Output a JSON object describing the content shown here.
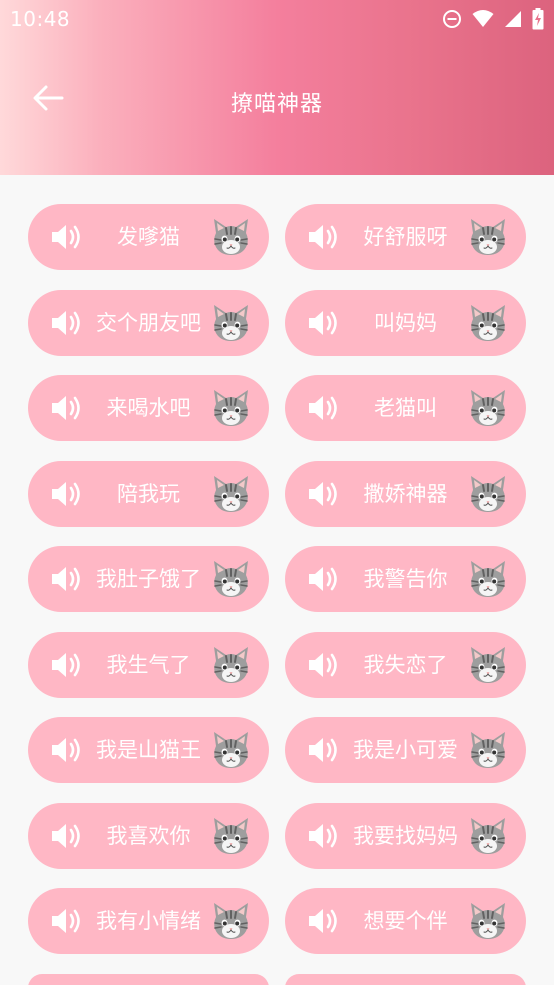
{
  "status_bar": {
    "time": "10:48"
  },
  "header": {
    "title": "撩喵神器"
  },
  "buttons": [
    {
      "label": "发嗲猫"
    },
    {
      "label": "好舒服呀"
    },
    {
      "label": "交个朋友吧"
    },
    {
      "label": "叫妈妈"
    },
    {
      "label": "来喝水吧"
    },
    {
      "label": "老猫叫"
    },
    {
      "label": "陪我玩"
    },
    {
      "label": "撒娇神器"
    },
    {
      "label": "我肚子饿了"
    },
    {
      "label": "我警告你"
    },
    {
      "label": "我生气了"
    },
    {
      "label": "我失恋了"
    },
    {
      "label": "我是山猫王"
    },
    {
      "label": "我是小可爱"
    },
    {
      "label": "我喜欢你"
    },
    {
      "label": "我要找妈妈"
    },
    {
      "label": "我有小情绪"
    },
    {
      "label": "想要个伴"
    }
  ],
  "colors": {
    "header_gradient_start": "#ffd9da",
    "header_gradient_end": "#dc637e",
    "pill_background": "#ffb7c5",
    "text": "#ffffff"
  },
  "icons": {
    "back": "arrow-left-icon",
    "button_left": "speaker-icon",
    "button_right": "cat-face-icon"
  }
}
